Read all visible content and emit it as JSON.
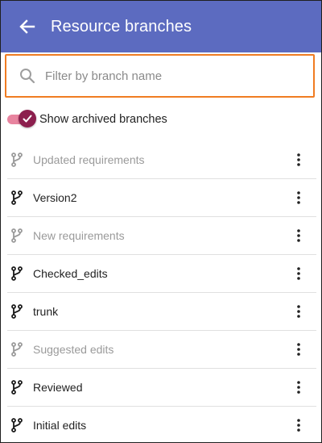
{
  "header": {
    "title": "Resource branches",
    "back_icon": "arrow-left-icon",
    "background": "#5c6bc0"
  },
  "filter": {
    "placeholder": "Filter by branch name",
    "value": "",
    "icon": "search-icon",
    "focus_border_color": "#f07c22"
  },
  "toggle": {
    "label": "Show archived branches",
    "checked": true,
    "accent": "#8c1f4e"
  },
  "branches": [
    {
      "name": "Updated requirements",
      "archived": true
    },
    {
      "name": "Version2",
      "archived": false
    },
    {
      "name": "New requirements",
      "archived": true
    },
    {
      "name": "Checked_edits",
      "archived": false
    },
    {
      "name": "trunk",
      "archived": false
    },
    {
      "name": "Suggested edits",
      "archived": true
    },
    {
      "name": "Reviewed",
      "archived": false
    },
    {
      "name": "Initial edits",
      "archived": false
    }
  ]
}
